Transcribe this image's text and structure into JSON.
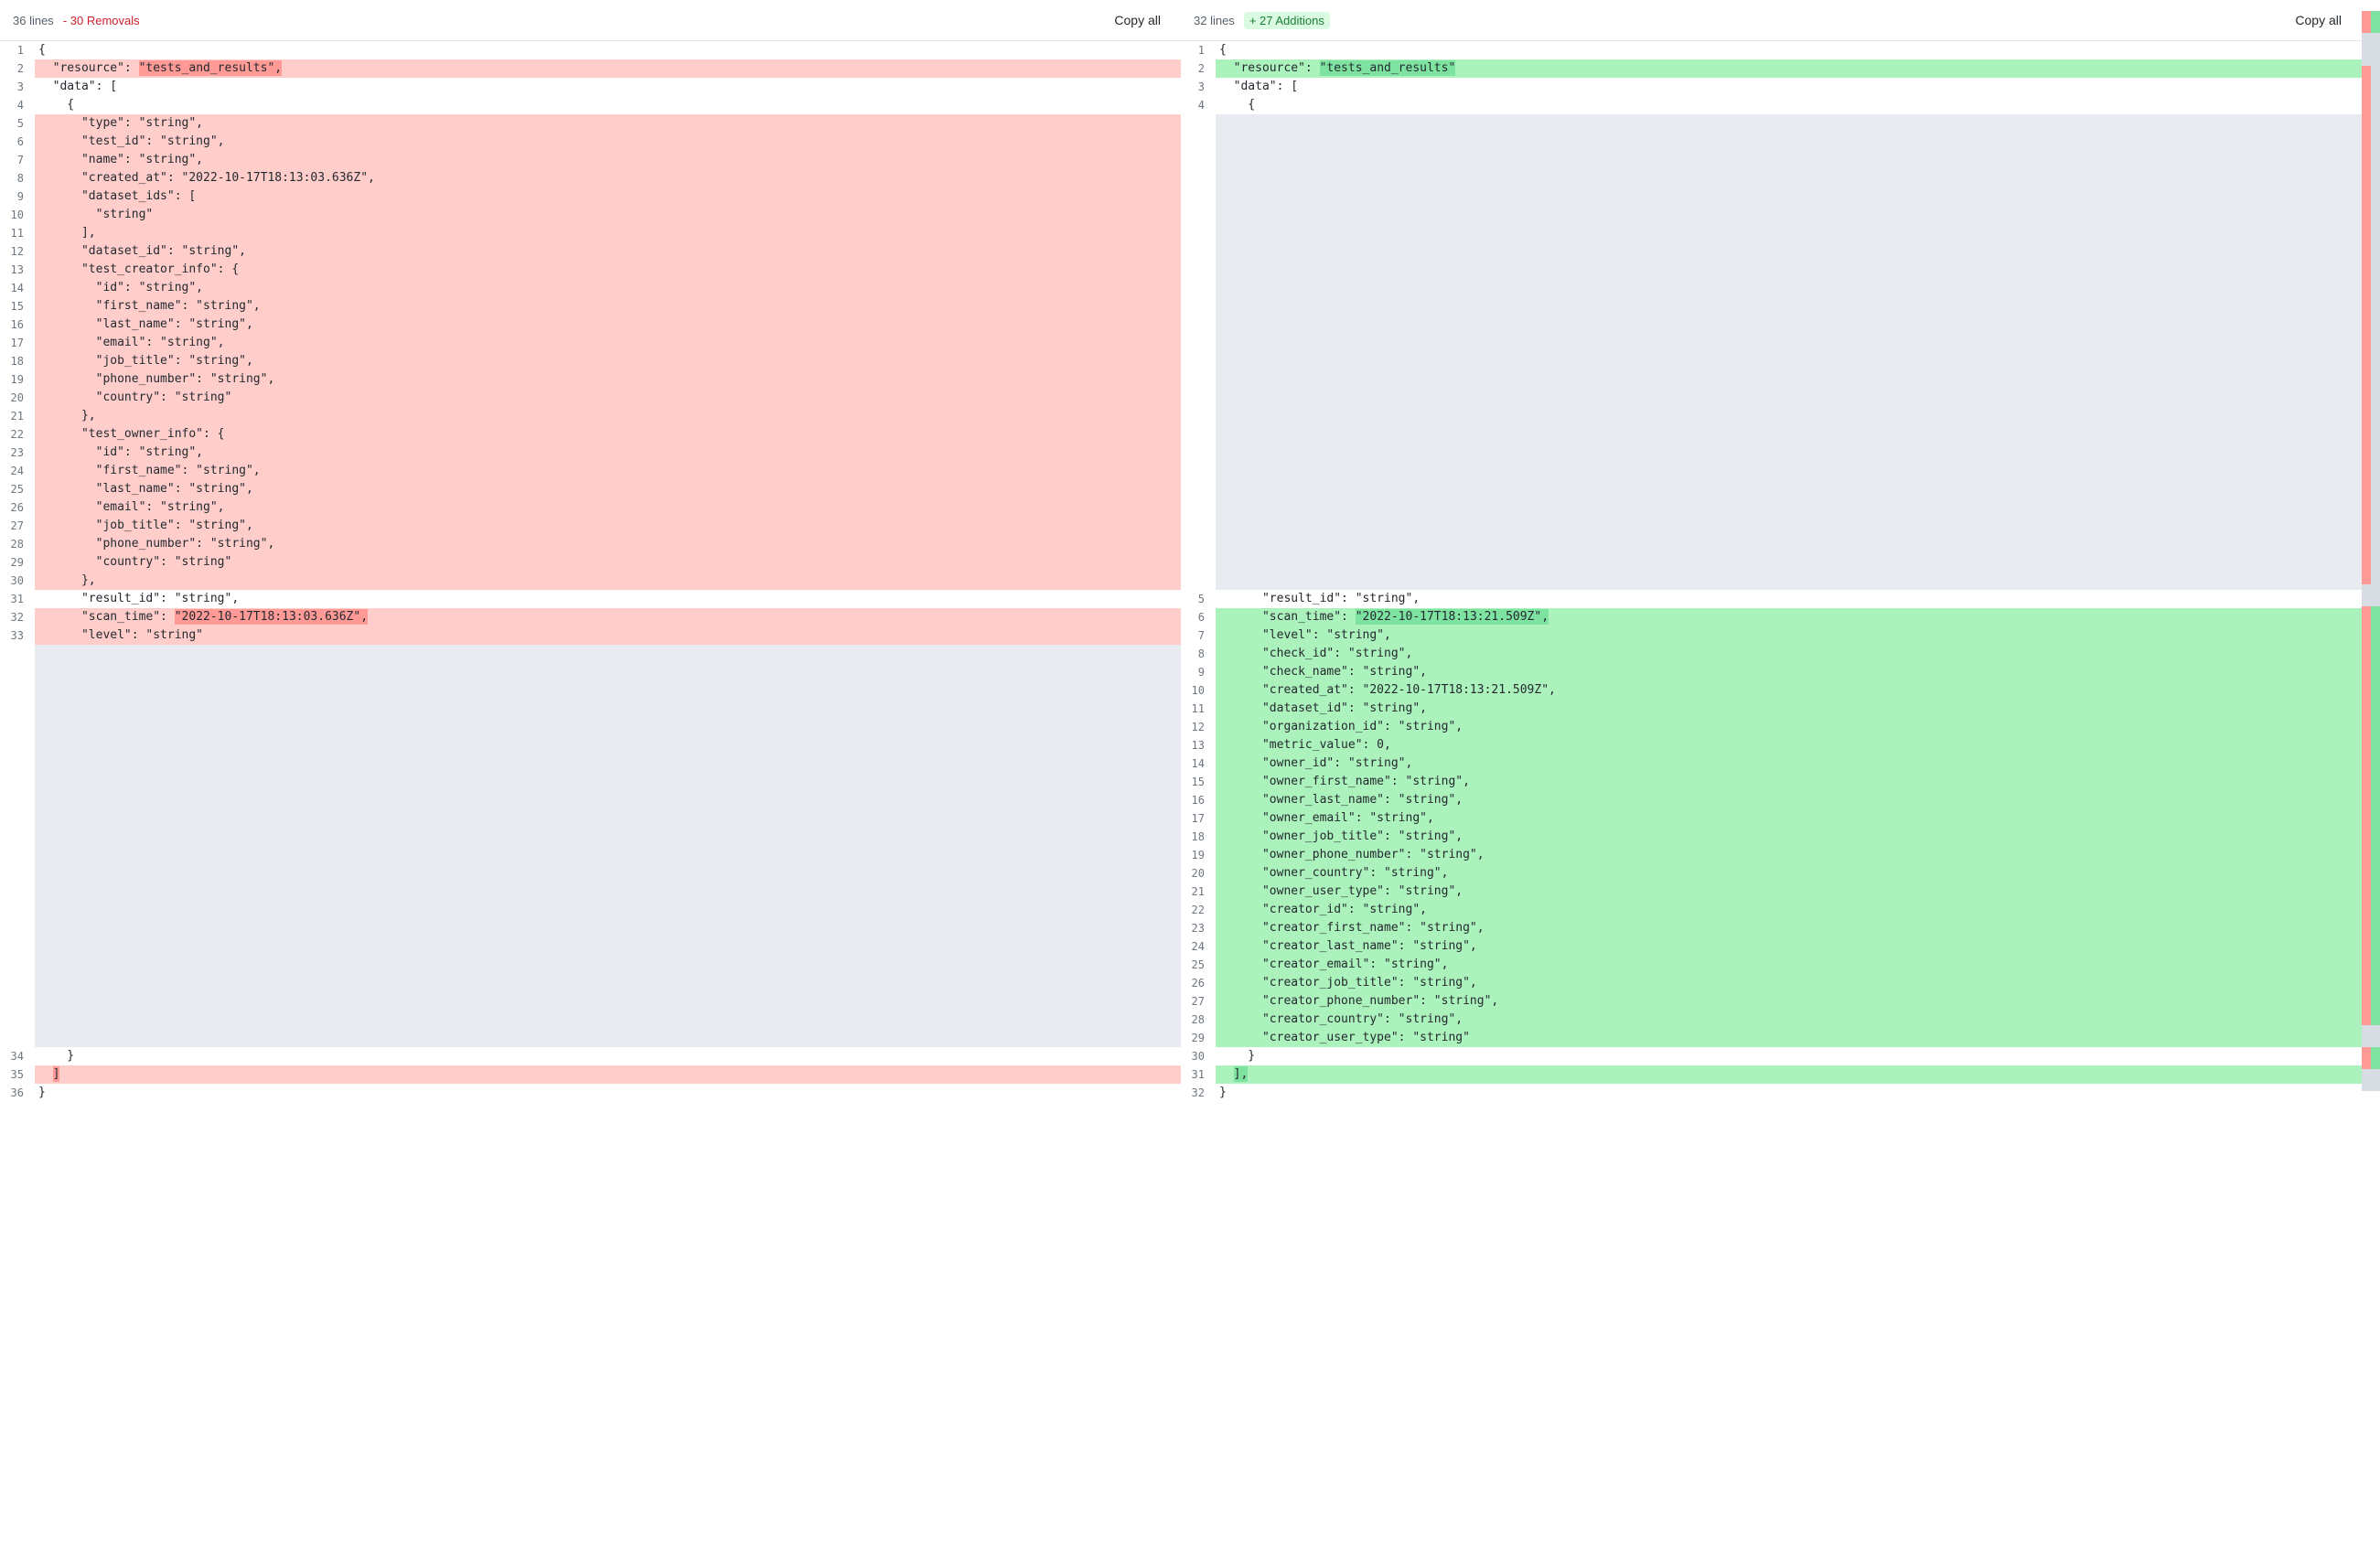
{
  "left": {
    "lines_label": "36 lines",
    "change_label": "- 30 Removals",
    "copy_label": "Copy all",
    "rows": [
      {
        "n": "1",
        "cls": "",
        "text": "{"
      },
      {
        "n": "2",
        "cls": "line-removed",
        "text": "  \"resource\": ",
        "hl": "\"tests_and_results\",",
        "hlcls": "highlight-removed"
      },
      {
        "n": "3",
        "cls": "",
        "text": "  \"data\": ["
      },
      {
        "n": "4",
        "cls": "",
        "text": "    {"
      },
      {
        "n": "5",
        "cls": "line-removed",
        "text": "      \"type\": \"string\","
      },
      {
        "n": "6",
        "cls": "line-removed",
        "text": "      \"test_id\": \"string\","
      },
      {
        "n": "7",
        "cls": "line-removed",
        "text": "      \"name\": \"string\","
      },
      {
        "n": "8",
        "cls": "line-removed",
        "text": "      \"created_at\": \"2022-10-17T18:13:03.636Z\","
      },
      {
        "n": "9",
        "cls": "line-removed",
        "text": "      \"dataset_ids\": ["
      },
      {
        "n": "10",
        "cls": "line-removed",
        "text": "        \"string\""
      },
      {
        "n": "11",
        "cls": "line-removed",
        "text": "      ],"
      },
      {
        "n": "12",
        "cls": "line-removed",
        "text": "      \"dataset_id\": \"string\","
      },
      {
        "n": "13",
        "cls": "line-removed",
        "text": "      \"test_creator_info\": {"
      },
      {
        "n": "14",
        "cls": "line-removed",
        "text": "        \"id\": \"string\","
      },
      {
        "n": "15",
        "cls": "line-removed",
        "text": "        \"first_name\": \"string\","
      },
      {
        "n": "16",
        "cls": "line-removed",
        "text": "        \"last_name\": \"string\","
      },
      {
        "n": "17",
        "cls": "line-removed",
        "text": "        \"email\": \"string\","
      },
      {
        "n": "18",
        "cls": "line-removed",
        "text": "        \"job_title\": \"string\","
      },
      {
        "n": "19",
        "cls": "line-removed",
        "text": "        \"phone_number\": \"string\","
      },
      {
        "n": "20",
        "cls": "line-removed",
        "text": "        \"country\": \"string\""
      },
      {
        "n": "21",
        "cls": "line-removed",
        "text": "      },"
      },
      {
        "n": "22",
        "cls": "line-removed",
        "text": "      \"test_owner_info\": {"
      },
      {
        "n": "23",
        "cls": "line-removed",
        "text": "        \"id\": \"string\","
      },
      {
        "n": "24",
        "cls": "line-removed",
        "text": "        \"first_name\": \"string\","
      },
      {
        "n": "25",
        "cls": "line-removed",
        "text": "        \"last_name\": \"string\","
      },
      {
        "n": "26",
        "cls": "line-removed",
        "text": "        \"email\": \"string\","
      },
      {
        "n": "27",
        "cls": "line-removed",
        "text": "        \"job_title\": \"string\","
      },
      {
        "n": "28",
        "cls": "line-removed",
        "text": "        \"phone_number\": \"string\","
      },
      {
        "n": "29",
        "cls": "line-removed",
        "text": "        \"country\": \"string\""
      },
      {
        "n": "30",
        "cls": "line-removed",
        "text": "      },"
      },
      {
        "n": "31",
        "cls": "",
        "text": "      \"result_id\": \"string\","
      },
      {
        "n": "32",
        "cls": "line-removed",
        "text": "      \"scan_time\": ",
        "hl": "\"2022-10-17T18:13:03.636Z\",",
        "hlcls": "highlight-removed"
      },
      {
        "n": "33",
        "cls": "line-removed",
        "text": "      \"level\": \"string\""
      },
      {
        "n": "",
        "cls": "line-spacer",
        "text": " "
      },
      {
        "n": "",
        "cls": "line-spacer",
        "text": " "
      },
      {
        "n": "",
        "cls": "line-spacer",
        "text": " "
      },
      {
        "n": "",
        "cls": "line-spacer",
        "text": " "
      },
      {
        "n": "",
        "cls": "line-spacer",
        "text": " "
      },
      {
        "n": "",
        "cls": "line-spacer",
        "text": " "
      },
      {
        "n": "",
        "cls": "line-spacer",
        "text": " "
      },
      {
        "n": "",
        "cls": "line-spacer",
        "text": " "
      },
      {
        "n": "",
        "cls": "line-spacer",
        "text": " "
      },
      {
        "n": "",
        "cls": "line-spacer",
        "text": " "
      },
      {
        "n": "",
        "cls": "line-spacer",
        "text": " "
      },
      {
        "n": "",
        "cls": "line-spacer",
        "text": " "
      },
      {
        "n": "",
        "cls": "line-spacer",
        "text": " "
      },
      {
        "n": "",
        "cls": "line-spacer",
        "text": " "
      },
      {
        "n": "",
        "cls": "line-spacer",
        "text": " "
      },
      {
        "n": "",
        "cls": "line-spacer",
        "text": " "
      },
      {
        "n": "",
        "cls": "line-spacer",
        "text": " "
      },
      {
        "n": "",
        "cls": "line-spacer",
        "text": " "
      },
      {
        "n": "",
        "cls": "line-spacer",
        "text": " "
      },
      {
        "n": "",
        "cls": "line-spacer",
        "text": " "
      },
      {
        "n": "",
        "cls": "line-spacer",
        "text": " "
      },
      {
        "n": "",
        "cls": "line-spacer",
        "text": " "
      },
      {
        "n": "34",
        "cls": "",
        "text": "    }"
      },
      {
        "n": "35",
        "cls": "line-removed",
        "text": "  ",
        "hl": "]",
        "hlcls": "highlight-removed"
      },
      {
        "n": "36",
        "cls": "",
        "text": "}"
      }
    ]
  },
  "right": {
    "lines_label": "32 lines",
    "change_label": "+ 27 Additions",
    "copy_label": "Copy all",
    "rows": [
      {
        "n": "1",
        "cls": "",
        "text": "{"
      },
      {
        "n": "2",
        "cls": "line-added",
        "text": "  \"resource\": ",
        "hl": "\"tests_and_results\"",
        "hlcls": "highlight-added"
      },
      {
        "n": "3",
        "cls": "",
        "text": "  \"data\": ["
      },
      {
        "n": "4",
        "cls": "",
        "text": "    {"
      },
      {
        "n": "",
        "cls": "line-spacer",
        "text": " "
      },
      {
        "n": "",
        "cls": "line-spacer",
        "text": " "
      },
      {
        "n": "",
        "cls": "line-spacer",
        "text": " "
      },
      {
        "n": "",
        "cls": "line-spacer",
        "text": " "
      },
      {
        "n": "",
        "cls": "line-spacer",
        "text": " "
      },
      {
        "n": "",
        "cls": "line-spacer",
        "text": " "
      },
      {
        "n": "",
        "cls": "line-spacer",
        "text": " "
      },
      {
        "n": "",
        "cls": "line-spacer",
        "text": " "
      },
      {
        "n": "",
        "cls": "line-spacer",
        "text": " "
      },
      {
        "n": "",
        "cls": "line-spacer",
        "text": " "
      },
      {
        "n": "",
        "cls": "line-spacer",
        "text": " "
      },
      {
        "n": "",
        "cls": "line-spacer",
        "text": " "
      },
      {
        "n": "",
        "cls": "line-spacer",
        "text": " "
      },
      {
        "n": "",
        "cls": "line-spacer",
        "text": " "
      },
      {
        "n": "",
        "cls": "line-spacer",
        "text": " "
      },
      {
        "n": "",
        "cls": "line-spacer",
        "text": " "
      },
      {
        "n": "",
        "cls": "line-spacer",
        "text": " "
      },
      {
        "n": "",
        "cls": "line-spacer",
        "text": " "
      },
      {
        "n": "",
        "cls": "line-spacer",
        "text": " "
      },
      {
        "n": "",
        "cls": "line-spacer",
        "text": " "
      },
      {
        "n": "",
        "cls": "line-spacer",
        "text": " "
      },
      {
        "n": "",
        "cls": "line-spacer",
        "text": " "
      },
      {
        "n": "",
        "cls": "line-spacer",
        "text": " "
      },
      {
        "n": "",
        "cls": "line-spacer",
        "text": " "
      },
      {
        "n": "",
        "cls": "line-spacer",
        "text": " "
      },
      {
        "n": "",
        "cls": "line-spacer",
        "text": " "
      },
      {
        "n": "5",
        "cls": "",
        "text": "      \"result_id\": \"string\","
      },
      {
        "n": "6",
        "cls": "line-added",
        "text": "      \"scan_time\": ",
        "hl": "\"2022-10-17T18:13:21.509Z\",",
        "hlcls": "highlight-added"
      },
      {
        "n": "7",
        "cls": "line-added",
        "text": "      \"level\": \"string\","
      },
      {
        "n": "8",
        "cls": "line-added",
        "text": "      \"check_id\": \"string\","
      },
      {
        "n": "9",
        "cls": "line-added",
        "text": "      \"check_name\": \"string\","
      },
      {
        "n": "10",
        "cls": "line-added",
        "text": "      \"created_at\": \"2022-10-17T18:13:21.509Z\","
      },
      {
        "n": "11",
        "cls": "line-added",
        "text": "      \"dataset_id\": \"string\","
      },
      {
        "n": "12",
        "cls": "line-added",
        "text": "      \"organization_id\": \"string\","
      },
      {
        "n": "13",
        "cls": "line-added",
        "text": "      \"metric_value\": 0,"
      },
      {
        "n": "14",
        "cls": "line-added",
        "text": "      \"owner_id\": \"string\","
      },
      {
        "n": "15",
        "cls": "line-added",
        "text": "      \"owner_first_name\": \"string\","
      },
      {
        "n": "16",
        "cls": "line-added",
        "text": "      \"owner_last_name\": \"string\","
      },
      {
        "n": "17",
        "cls": "line-added",
        "text": "      \"owner_email\": \"string\","
      },
      {
        "n": "18",
        "cls": "line-added",
        "text": "      \"owner_job_title\": \"string\","
      },
      {
        "n": "19",
        "cls": "line-added",
        "text": "      \"owner_phone_number\": \"string\","
      },
      {
        "n": "20",
        "cls": "line-added",
        "text": "      \"owner_country\": \"string\","
      },
      {
        "n": "21",
        "cls": "line-added",
        "text": "      \"owner_user_type\": \"string\","
      },
      {
        "n": "22",
        "cls": "line-added",
        "text": "      \"creator_id\": \"string\","
      },
      {
        "n": "23",
        "cls": "line-added",
        "text": "      \"creator_first_name\": \"string\","
      },
      {
        "n": "24",
        "cls": "line-added",
        "text": "      \"creator_last_name\": \"string\","
      },
      {
        "n": "25",
        "cls": "line-added",
        "text": "      \"creator_email\": \"string\","
      },
      {
        "n": "26",
        "cls": "line-added",
        "text": "      \"creator_job_title\": \"string\","
      },
      {
        "n": "27",
        "cls": "line-added",
        "text": "      \"creator_phone_number\": \"string\","
      },
      {
        "n": "28",
        "cls": "line-added",
        "text": "      \"creator_country\": \"string\","
      },
      {
        "n": "29",
        "cls": "line-added",
        "text": "      \"creator_user_type\": \"string\""
      },
      {
        "n": "30",
        "cls": "",
        "text": "    }"
      },
      {
        "n": "31",
        "cls": "line-added",
        "text": "  ",
        "hl": "],",
        "hlcls": "highlight-added"
      },
      {
        "n": "32",
        "cls": "",
        "text": "}"
      }
    ]
  },
  "minimap": {
    "left_col": [
      {
        "top": "1%",
        "h": "2%",
        "c": "mm-red"
      },
      {
        "top": "3%",
        "h": "3%",
        "c": "mm-gray"
      },
      {
        "top": "6%",
        "h": "47%",
        "c": "mm-red"
      },
      {
        "top": "53%",
        "h": "2%",
        "c": "mm-gray"
      },
      {
        "top": "55%",
        "h": "38%",
        "c": "mm-red"
      },
      {
        "top": "93%",
        "h": "2%",
        "c": "mm-gray"
      },
      {
        "top": "95%",
        "h": "2%",
        "c": "mm-red"
      },
      {
        "top": "97%",
        "h": "2%",
        "c": "mm-gray"
      }
    ],
    "right_col": [
      {
        "top": "1%",
        "h": "2%",
        "c": "mm-green"
      },
      {
        "top": "3%",
        "h": "3%",
        "c": "mm-gray"
      },
      {
        "top": "6%",
        "h": "47%",
        "c": "mm-gray"
      },
      {
        "top": "53%",
        "h": "2%",
        "c": "mm-gray"
      },
      {
        "top": "55%",
        "h": "38%",
        "c": "mm-green"
      },
      {
        "top": "93%",
        "h": "2%",
        "c": "mm-gray"
      },
      {
        "top": "95%",
        "h": "2%",
        "c": "mm-green"
      },
      {
        "top": "97%",
        "h": "2%",
        "c": "mm-gray"
      }
    ]
  }
}
